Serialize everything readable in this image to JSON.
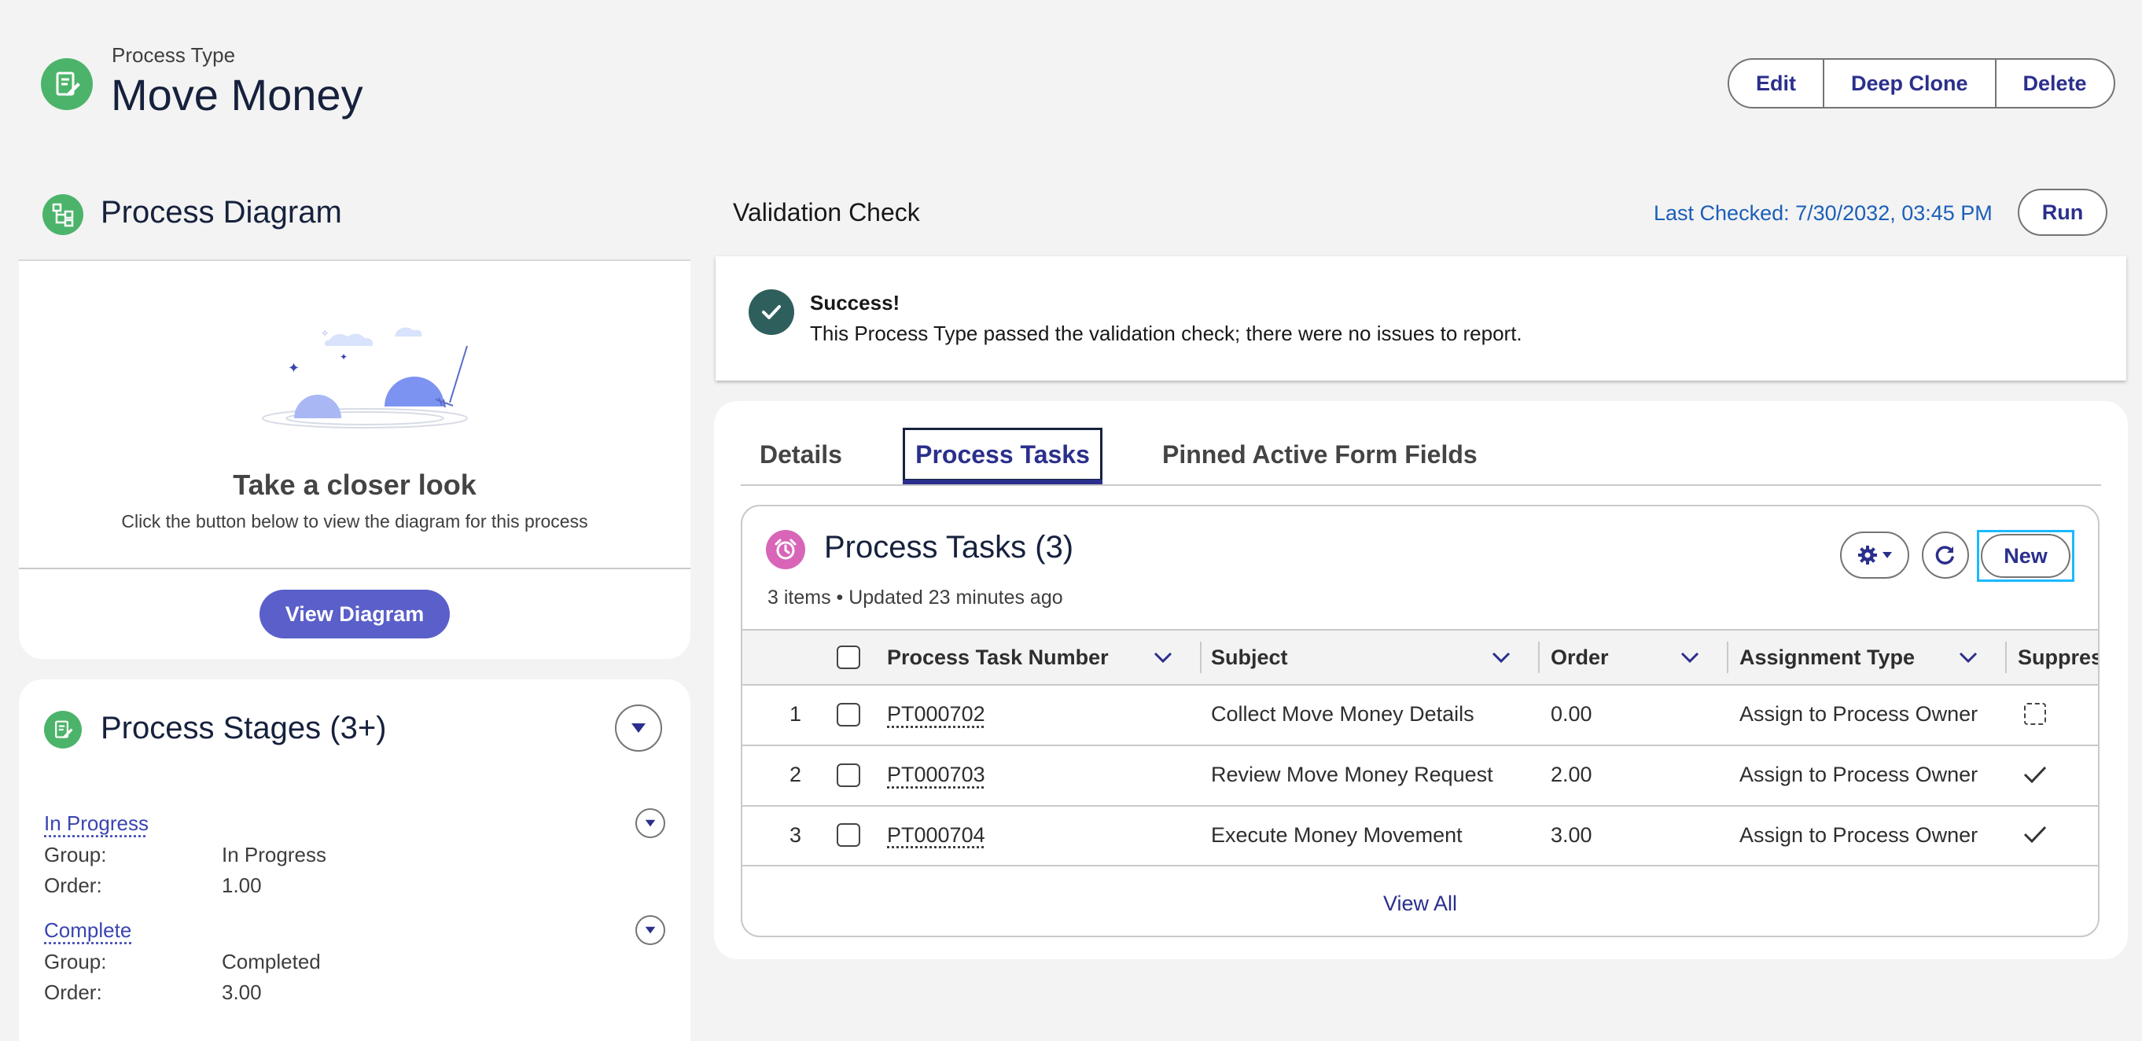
{
  "header": {
    "object_label": "Process Type",
    "title": "Move Money",
    "icon": "process-type-icon",
    "actions": [
      "Edit",
      "Deep Clone",
      "Delete"
    ]
  },
  "diagram": {
    "title": "Process Diagram",
    "icon": "hierarchy-icon",
    "heading": "Take a closer look",
    "text": "Click the button below to view the diagram for this process",
    "button": "View Diagram"
  },
  "stages": {
    "title": "Process Stages (3+)",
    "items": [
      {
        "name": "In Progress",
        "group_label": "Group:",
        "group": "In Progress",
        "order_label": "Order:",
        "order": "1.00"
      },
      {
        "name": "Complete",
        "group_label": "Group:",
        "group": "Completed",
        "order_label": "Order:",
        "order": "3.00"
      }
    ]
  },
  "validation": {
    "title": "Validation Check",
    "last_checked": "Last Checked: 7/30/2032, 03:45 PM",
    "run": "Run",
    "status_title": "Success!",
    "status_text": "This Process Type passed the validation check; there were no issues to report."
  },
  "tabs": {
    "items": [
      "Details",
      "Process Tasks",
      "Pinned Active Form Fields"
    ],
    "active": "Process Tasks"
  },
  "tasks": {
    "title": "Process Tasks (3)",
    "meta": "3 items • Updated 23 minutes ago",
    "new_label": "New",
    "columns": [
      "Process Task Number",
      "Subject",
      "Order",
      "Assignment Type",
      "Suppres"
    ],
    "rows": [
      {
        "num": "1",
        "task": "PT000702",
        "subject": "Collect Move Money Details",
        "order": "0.00",
        "assignment": "Assign to Process Owner",
        "suppress": false
      },
      {
        "num": "2",
        "task": "PT000703",
        "subject": "Review Move Money Request",
        "order": "2.00",
        "assignment": "Assign to Process Owner",
        "suppress": true
      },
      {
        "num": "3",
        "task": "PT000704",
        "subject": "Execute Money Movement",
        "order": "3.00",
        "assignment": "Assign to Process Owner",
        "suppress": true
      }
    ],
    "view_all": "View All"
  },
  "colors": {
    "accent": "#2b2f8c",
    "brand_purple": "#5a5fc9",
    "green": "#3ba55c",
    "success": "#2e5f5c",
    "focus": "#1ab9ff"
  }
}
